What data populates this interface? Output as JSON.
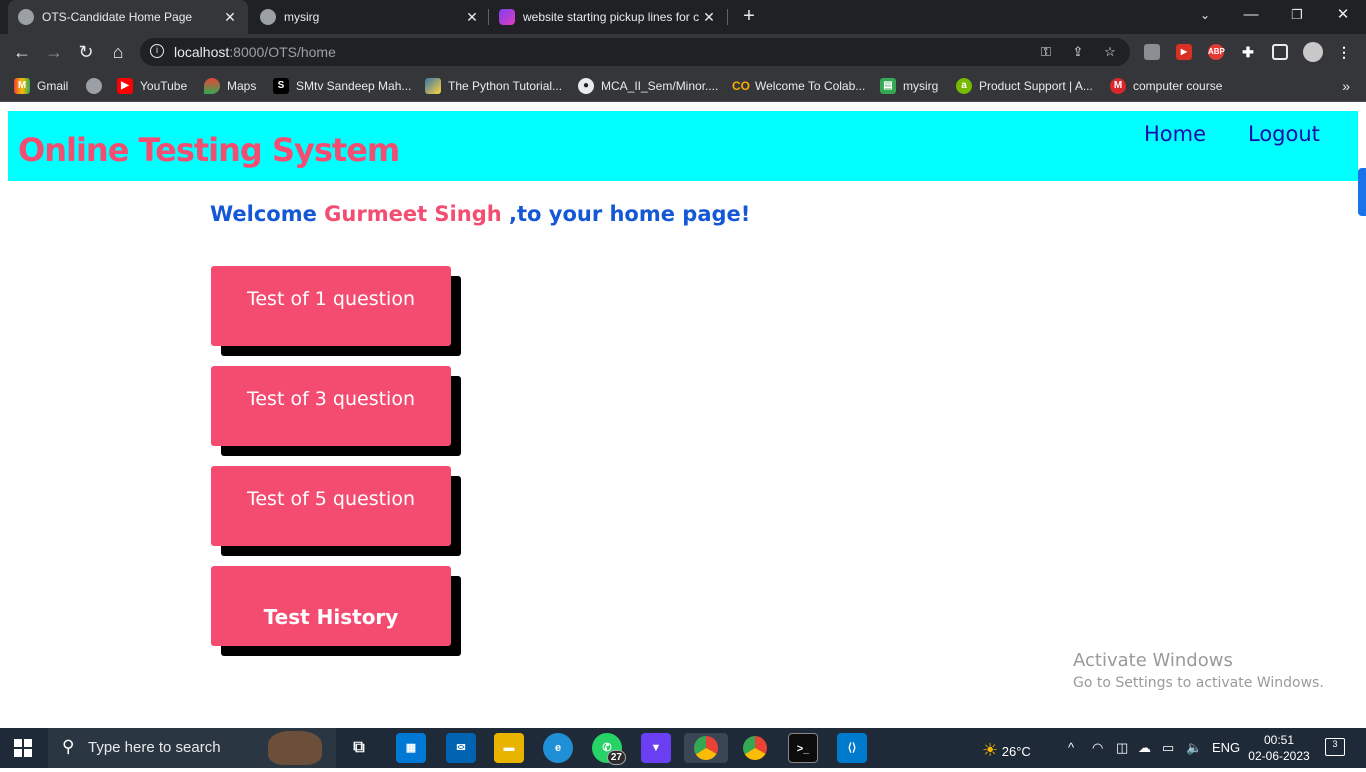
{
  "browser": {
    "tabs": [
      {
        "title": "OTS-Candidate Home Page",
        "active": true
      },
      {
        "title": "mysirg",
        "active": false
      },
      {
        "title": "website starting pickup lines for c",
        "active": false
      }
    ],
    "url_host": "localhost",
    "url_path": ":8000/OTS/home",
    "bookmarks": [
      {
        "label": "Gmail",
        "icon": "gmail-icon"
      },
      {
        "label": "",
        "icon": "globe-icon"
      },
      {
        "label": "YouTube",
        "icon": "youtube-icon"
      },
      {
        "label": "Maps",
        "icon": "maps-icon"
      },
      {
        "label": "SMtv Sandeep Mah...",
        "icon": "smtv-icon"
      },
      {
        "label": "The Python Tutorial...",
        "icon": "python-icon"
      },
      {
        "label": "MCA_II_Sem/Minor....",
        "icon": "github-icon"
      },
      {
        "label": "Welcome To Colab...",
        "icon": "colab-icon"
      },
      {
        "label": "mysirg",
        "icon": "sheets-icon"
      },
      {
        "label": "Product Support | A...",
        "icon": "product-support-icon"
      },
      {
        "label": "computer course",
        "icon": "mega-icon"
      }
    ]
  },
  "site": {
    "title": "Online Testing System",
    "nav": {
      "home": "Home",
      "logout": "Logout"
    },
    "welcome_prefix": "Welcome ",
    "user_name": "Gurmeet Singh",
    "welcome_suffix": " ,to your home page!",
    "buttons": [
      {
        "label": "Test of 1 question"
      },
      {
        "label": "Test of 3 question"
      },
      {
        "label": "Test of 5 question"
      },
      {
        "label": "Test History"
      }
    ],
    "colors": {
      "header_bg": "#00ffff",
      "accent": "#f44c71",
      "link": "#1a0dab",
      "welcome": "#1558d6"
    }
  },
  "watermark": {
    "line1": "Activate Windows",
    "line2": "Go to Settings to activate Windows."
  },
  "taskbar": {
    "search_placeholder": "Type here to search",
    "whatsapp_badge": "27",
    "weather": "26°C",
    "language": "ENG",
    "time": "00:51",
    "date": "02-06-2023",
    "notifications": "3"
  }
}
